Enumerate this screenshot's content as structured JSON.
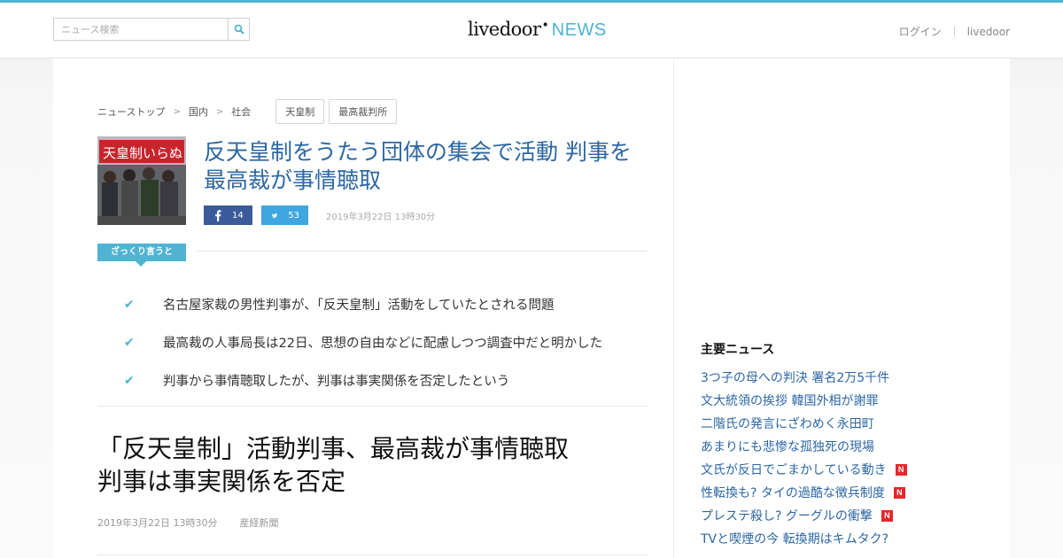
{
  "header": {
    "search_placeholder": "ニュース検索",
    "logo_main": "livedoor",
    "logo_news": "NEWS",
    "login": "ログイン",
    "livedoor_link": "livedoor"
  },
  "breadcrumb": [
    "ニューストップ",
    "国内",
    "社会"
  ],
  "tags": [
    "天皇制",
    "最高裁判所"
  ],
  "article": {
    "headline": "反天皇制をうたう団体の集会で活動 判事を最高裁が事情聴取",
    "fb_count": "14",
    "tw_count": "53",
    "date": "2019年3月22日 13時30分",
    "summary_label": "ざっくり言うと",
    "points": [
      "名古屋家裁の男性判事が、「反天皇制」活動をしていたとされる問題",
      "最高裁の人事局長は22日、思想の自由などに配慮しつつ調査中だと明かした",
      "判事から事情聴取したが、判事は事実関係を否定したという"
    ],
    "title2": "「反天皇制」活動判事、最高裁が事情聴取\n判事は事実関係を否定",
    "date2": "2019年3月22日 13時30分",
    "source": "産経新聞"
  },
  "sidebar": {
    "title": "主要ニュース",
    "items": [
      {
        "label": "3つ子の母への判決 署名2万5千件",
        "new": false
      },
      {
        "label": "文大統領の挨拶 韓国外相が謝罪",
        "new": false
      },
      {
        "label": "二階氏の発言にざわめく永田町",
        "new": false
      },
      {
        "label": "あまりにも悲惨な孤独死の現場",
        "new": false
      },
      {
        "label": "文氏が反日でごまかしている動き",
        "new": true
      },
      {
        "label": "性転換も? タイの過酷な徴兵制度",
        "new": true
      },
      {
        "label": "プレステ殺し? グーグルの衝撃",
        "new": true
      },
      {
        "label": "TVと喫煙の今 転換期はキムタク?",
        "new": false
      }
    ],
    "new_badge": "N"
  },
  "colors": {
    "accent": "#4fb3d1",
    "link": "#2c67a4",
    "facebook": "#3b5a9a",
    "twitter": "#3ea6e0",
    "new_badge": "#e8262c"
  }
}
